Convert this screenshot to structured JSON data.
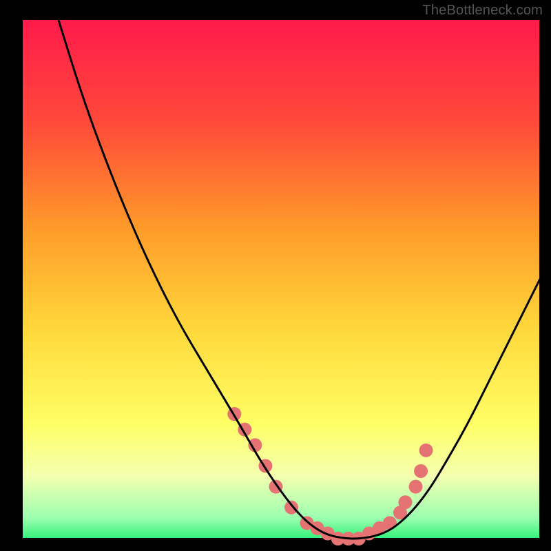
{
  "watermark": "TheBottleneck.com",
  "chart_data": {
    "type": "line",
    "title": "",
    "xlabel": "",
    "ylabel": "",
    "xlim": [
      0,
      100
    ],
    "ylim": [
      0,
      100
    ],
    "grid": false,
    "legend": false,
    "background_gradient": {
      "stops": [
        {
          "offset": 0.0,
          "color": "#ff1a4b"
        },
        {
          "offset": 0.2,
          "color": "#ff4a3a"
        },
        {
          "offset": 0.4,
          "color": "#ff9a2a"
        },
        {
          "offset": 0.6,
          "color": "#ffd93b"
        },
        {
          "offset": 0.78,
          "color": "#ffff66"
        },
        {
          "offset": 0.88,
          "color": "#f4ffb0"
        },
        {
          "offset": 0.96,
          "color": "#9cffb0"
        },
        {
          "offset": 1.0,
          "color": "#33f07a"
        }
      ]
    },
    "series": [
      {
        "name": "bottleneck-curve",
        "color": "#000000",
        "x": [
          7,
          12,
          18,
          24,
          30,
          36,
          42,
          46,
          50,
          54,
          58,
          62,
          66,
          70,
          73,
          76,
          79,
          82,
          86,
          90,
          94,
          98,
          100
        ],
        "values": [
          100,
          84,
          68,
          54,
          42,
          32,
          22,
          15,
          9,
          4,
          1,
          0,
          0,
          1,
          3,
          6,
          10,
          15,
          22,
          30,
          38,
          46,
          50
        ]
      }
    ],
    "markers": {
      "name": "bottleneck-markers",
      "color": "#e57373",
      "radius": 10,
      "x": [
        41,
        43,
        45,
        47,
        49,
        52,
        55,
        57,
        59,
        61,
        63,
        65,
        67,
        69,
        71,
        73,
        74,
        76,
        77,
        78
      ],
      "values": [
        24,
        21,
        18,
        14,
        10,
        6,
        3,
        2,
        1,
        0,
        0,
        0,
        1,
        2,
        3,
        5,
        7,
        10,
        13,
        17
      ]
    }
  }
}
